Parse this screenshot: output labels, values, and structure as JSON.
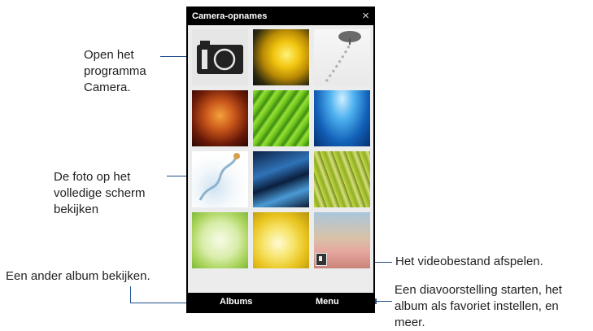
{
  "window": {
    "title": "Camera-opnames",
    "close_glyph": "×"
  },
  "bottom_bar": {
    "albums_label": "Albums",
    "menu_label": "Menu"
  },
  "callouts": {
    "camera": [
      "Open het",
      "programma",
      "Camera."
    ],
    "fullscreen": [
      "De foto op het",
      "volledige scherm",
      "bekijken"
    ],
    "album": "Een ander album bekijken.",
    "video": "Het videobestand afspelen.",
    "menu": [
      "Een diavoorstelling starten, het",
      "album als favoriet instellen, en",
      "meer."
    ]
  },
  "thumbnails": [
    {
      "name": "camera-app-icon"
    },
    {
      "name": "yellow-flower-photo"
    },
    {
      "name": "snow-tree-photo"
    },
    {
      "name": "orange-floral-photo"
    },
    {
      "name": "green-leaf-photo"
    },
    {
      "name": "underwater-light-photo"
    },
    {
      "name": "water-splash-photo"
    },
    {
      "name": "blue-water-photo"
    },
    {
      "name": "green-grass-photo"
    },
    {
      "name": "green-vines-photo"
    },
    {
      "name": "yellow-petals-photo"
    },
    {
      "name": "family-beach-video"
    }
  ],
  "colors": {
    "callout_line": "#1f4e8c",
    "bar": "#000000",
    "grid_bg": "#ececec"
  }
}
